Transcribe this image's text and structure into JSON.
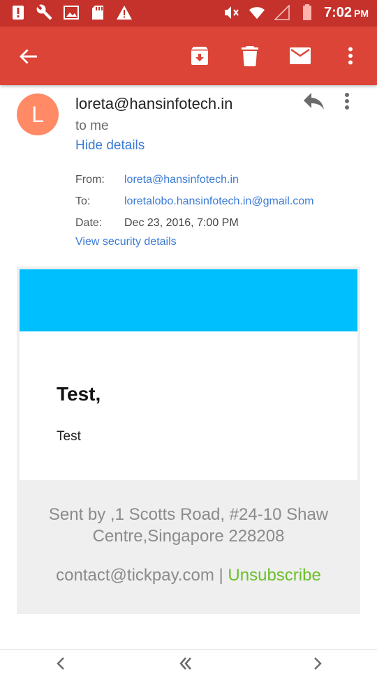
{
  "status_bar": {
    "time": "7:02",
    "ampm": "PM",
    "icons": [
      "alert-icon",
      "wrench-icon",
      "image-icon",
      "sd-card-icon",
      "warning-icon",
      "mute-icon",
      "wifi-icon",
      "signal-icon",
      "battery-icon"
    ]
  },
  "app_bar": {
    "back_icon": "arrow-back-icon",
    "actions": [
      "archive-icon",
      "delete-icon",
      "mark-unread-icon",
      "more-vert-icon"
    ],
    "colors": {
      "status_bar": "#c5322b",
      "app_bar": "#db4437"
    }
  },
  "message": {
    "avatar_letter": "L",
    "avatar_color": "#ff8a65",
    "sender": "loreta@hansinfotech.in",
    "to_me": "to me",
    "hide_details": "Hide details",
    "details": {
      "from_label": "From:",
      "from_value": "loreta@hansinfotech.in",
      "to_label": "To:",
      "to_value": "loretalobo.hansinfotech.in@gmail.com",
      "date_label": "Date:",
      "date_value": "Dec 23, 2016, 7:00 PM",
      "security_link": "View security details"
    }
  },
  "email_body": {
    "banner_color": "#00bfff",
    "heading": "Test,",
    "body": "Test",
    "footer_address": "Sent by ,1 Scotts Road, #24-10 Shaw Centre,Singapore 228208",
    "footer_contact": "contact@tickpay.com",
    "footer_separator": " | ",
    "unsubscribe": "Unsubscribe"
  }
}
